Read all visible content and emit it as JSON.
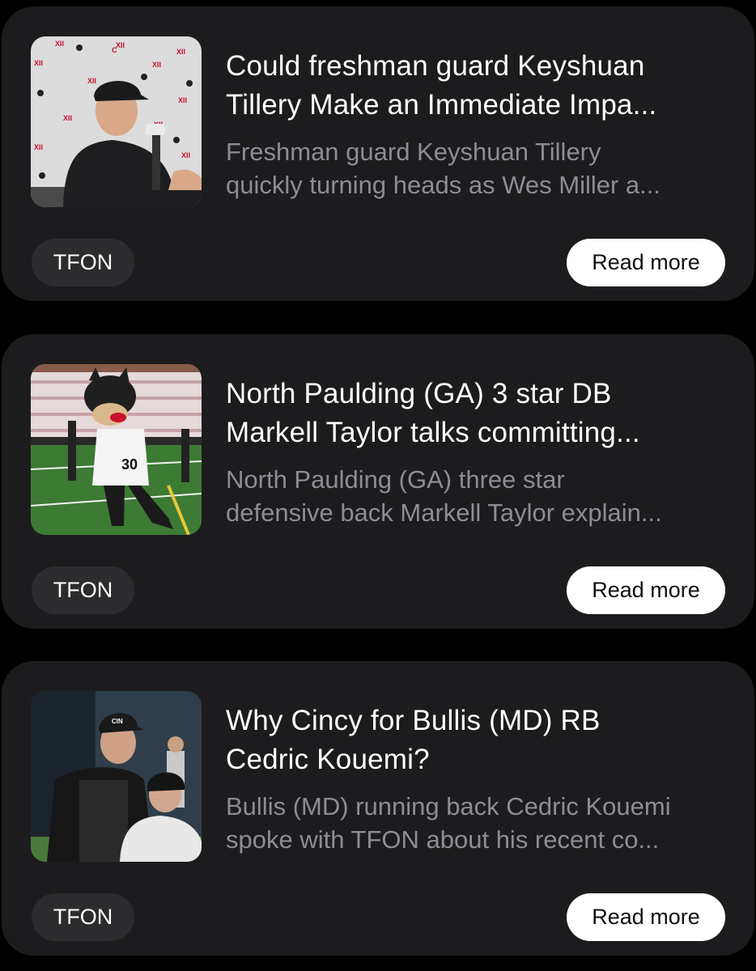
{
  "articles": [
    {
      "title_lines": [
        "Could freshman guard Keyshuan",
        "Tillery Make an Immediate Impa..."
      ],
      "summary_lines": [
        "Freshman guard Keyshuan Tillery",
        "quickly turning heads as Wes Miller a..."
      ],
      "source": "TFON",
      "cta": "Read more",
      "image": "coach at press conference with Big 12 and Cincinnati logo backdrop"
    },
    {
      "title_lines": [
        "North Paulding (GA) 3 star DB",
        "Markell Taylor talks committing..."
      ],
      "summary_lines": [
        "North Paulding (GA) three star",
        "defensive back Markell Taylor explain..."
      ],
      "source": "TFON",
      "cta": "Read more",
      "image": "Bearcat mascot on football field in front of crowd"
    },
    {
      "title_lines": [
        "Why Cincy for Bullis (MD) RB",
        "Cedric Kouemi?"
      ],
      "summary_lines": [
        "Bullis (MD) running back Cedric Kouemi",
        "spoke with TFON about his recent co..."
      ],
      "source": "TFON",
      "cta": "Read more",
      "image": "coach in Cincinnati cap with young fan on field"
    }
  ],
  "colors": {
    "background": "#000000",
    "card": "#1c1c1e",
    "chip": "#2c2c2e",
    "summary_text": "#8d8d92",
    "button": "#ffffff"
  }
}
